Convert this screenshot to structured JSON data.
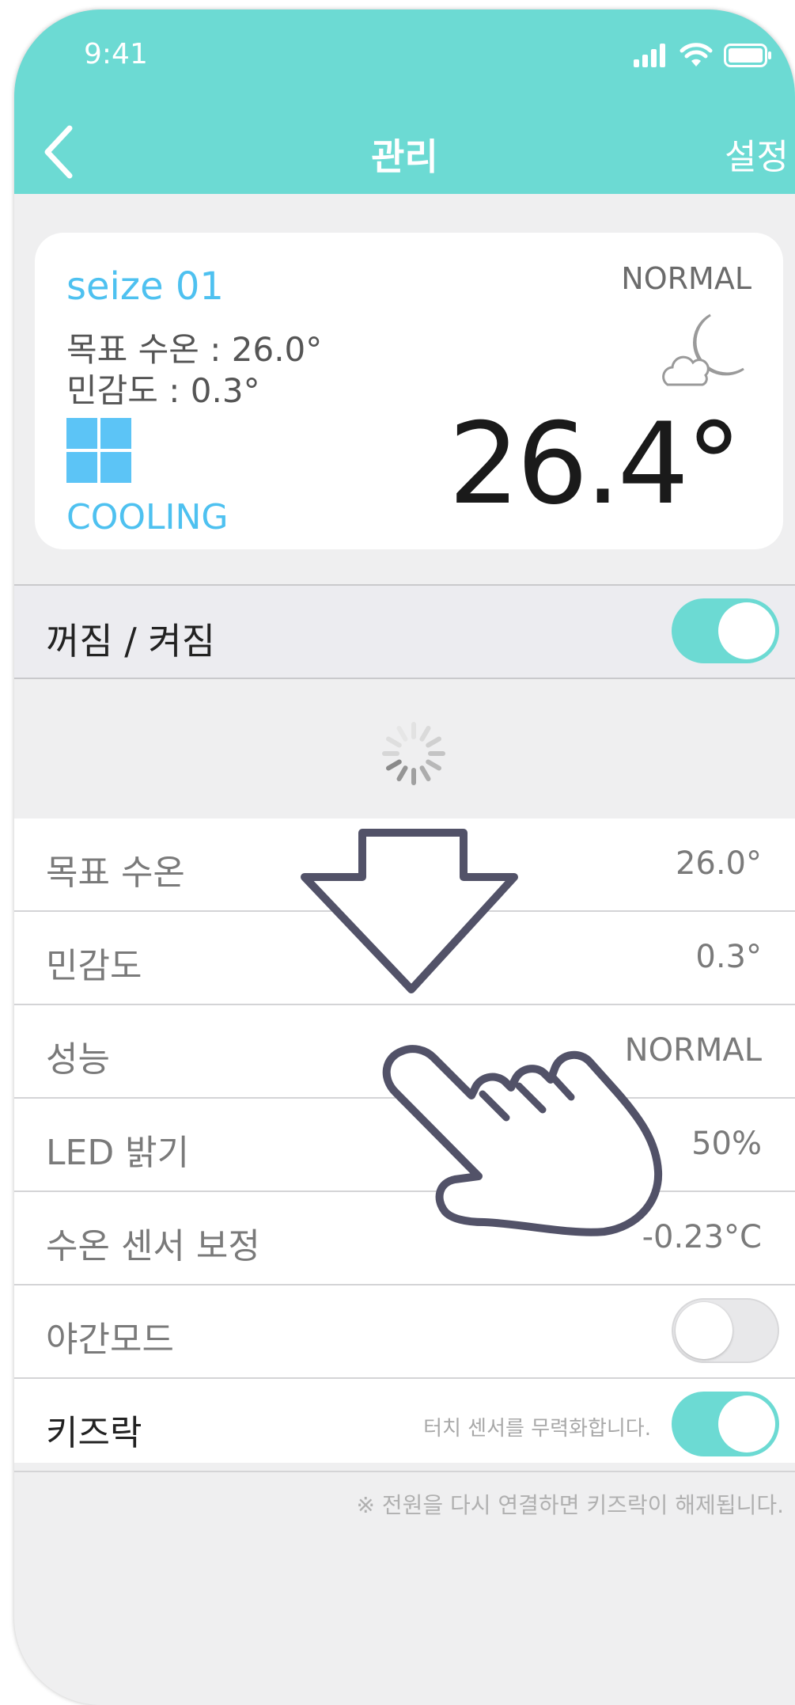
{
  "status_bar": {
    "time": "9:41"
  },
  "nav": {
    "title": "관리",
    "right_label": "설정"
  },
  "device_card": {
    "name": "seize 01",
    "target_line": "목표 수온 : 26.0°",
    "sensitivity_line": "민감도 : 0.3°",
    "mode_label": "COOLING",
    "performance": "NORMAL",
    "current_temp": "26.4°"
  },
  "power": {
    "label": "꺼짐 / 켜짐",
    "on": true
  },
  "settings": [
    {
      "label": "목표 수온",
      "value": "26.0°"
    },
    {
      "label": "민감도",
      "value": "0.3°"
    },
    {
      "label": "성능",
      "value": "NORMAL"
    },
    {
      "label": "LED 밝기",
      "value": "50%"
    },
    {
      "label": "수온 센서 보정",
      "value": "-0.23°C"
    },
    {
      "label": "야간모드",
      "on": false
    },
    {
      "label": "키즈락",
      "hint": "터치 센서를 무력화합니다.",
      "on": true
    }
  ],
  "footnote": "※ 전원을 다시 연결하면 키즈락이 해제됩니다.",
  "colors": {
    "header": "#6cdad3",
    "accent_blue": "#4ec1f0",
    "toggle_on": "#6cdad3"
  },
  "icons": [
    "signal-icon",
    "wifi-icon",
    "battery-icon",
    "back-chevron-icon",
    "moon-cloud-icon",
    "cooling-mode-icon",
    "loading-spinner-icon",
    "swipe-down-arrow-icon",
    "pointing-hand-icon"
  ]
}
